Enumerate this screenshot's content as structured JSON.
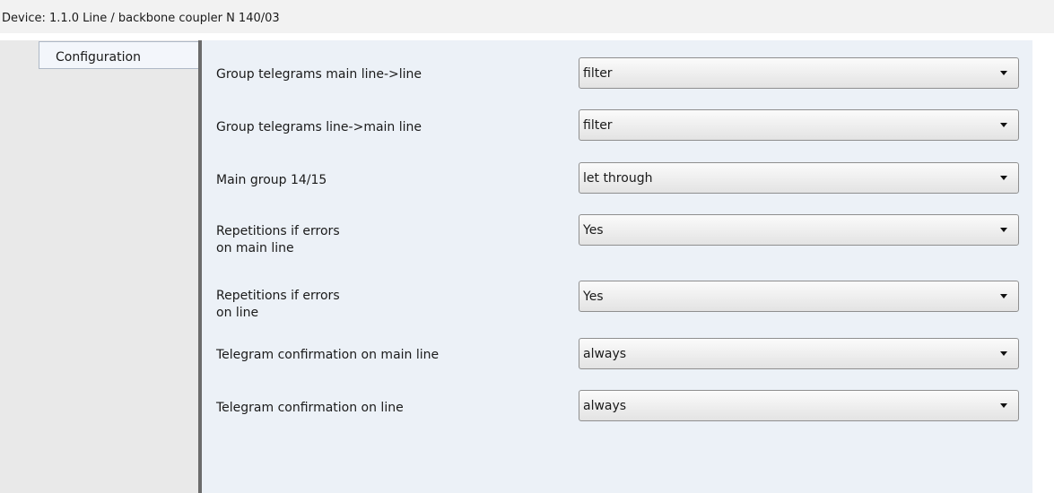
{
  "window": {
    "title": "Device: 1.1.0  Line / backbone coupler N 140/03"
  },
  "sidebar": {
    "tabs": [
      {
        "label": "Configuration"
      }
    ]
  },
  "parameters": [
    {
      "label": "Group telegrams main line->line",
      "value": "filter"
    },
    {
      "label": "Group telegrams line->main line",
      "value": "filter"
    },
    {
      "label": "Main group 14/15",
      "value": "let through"
    },
    {
      "label": "Repetitions if errors\non main line",
      "value": "Yes"
    },
    {
      "label": "Repetitions if errors\non line",
      "value": "Yes"
    },
    {
      "label": "Telegram confirmation on main line",
      "value": "always"
    },
    {
      "label": "Telegram confirmation on line",
      "value": "always"
    }
  ]
}
